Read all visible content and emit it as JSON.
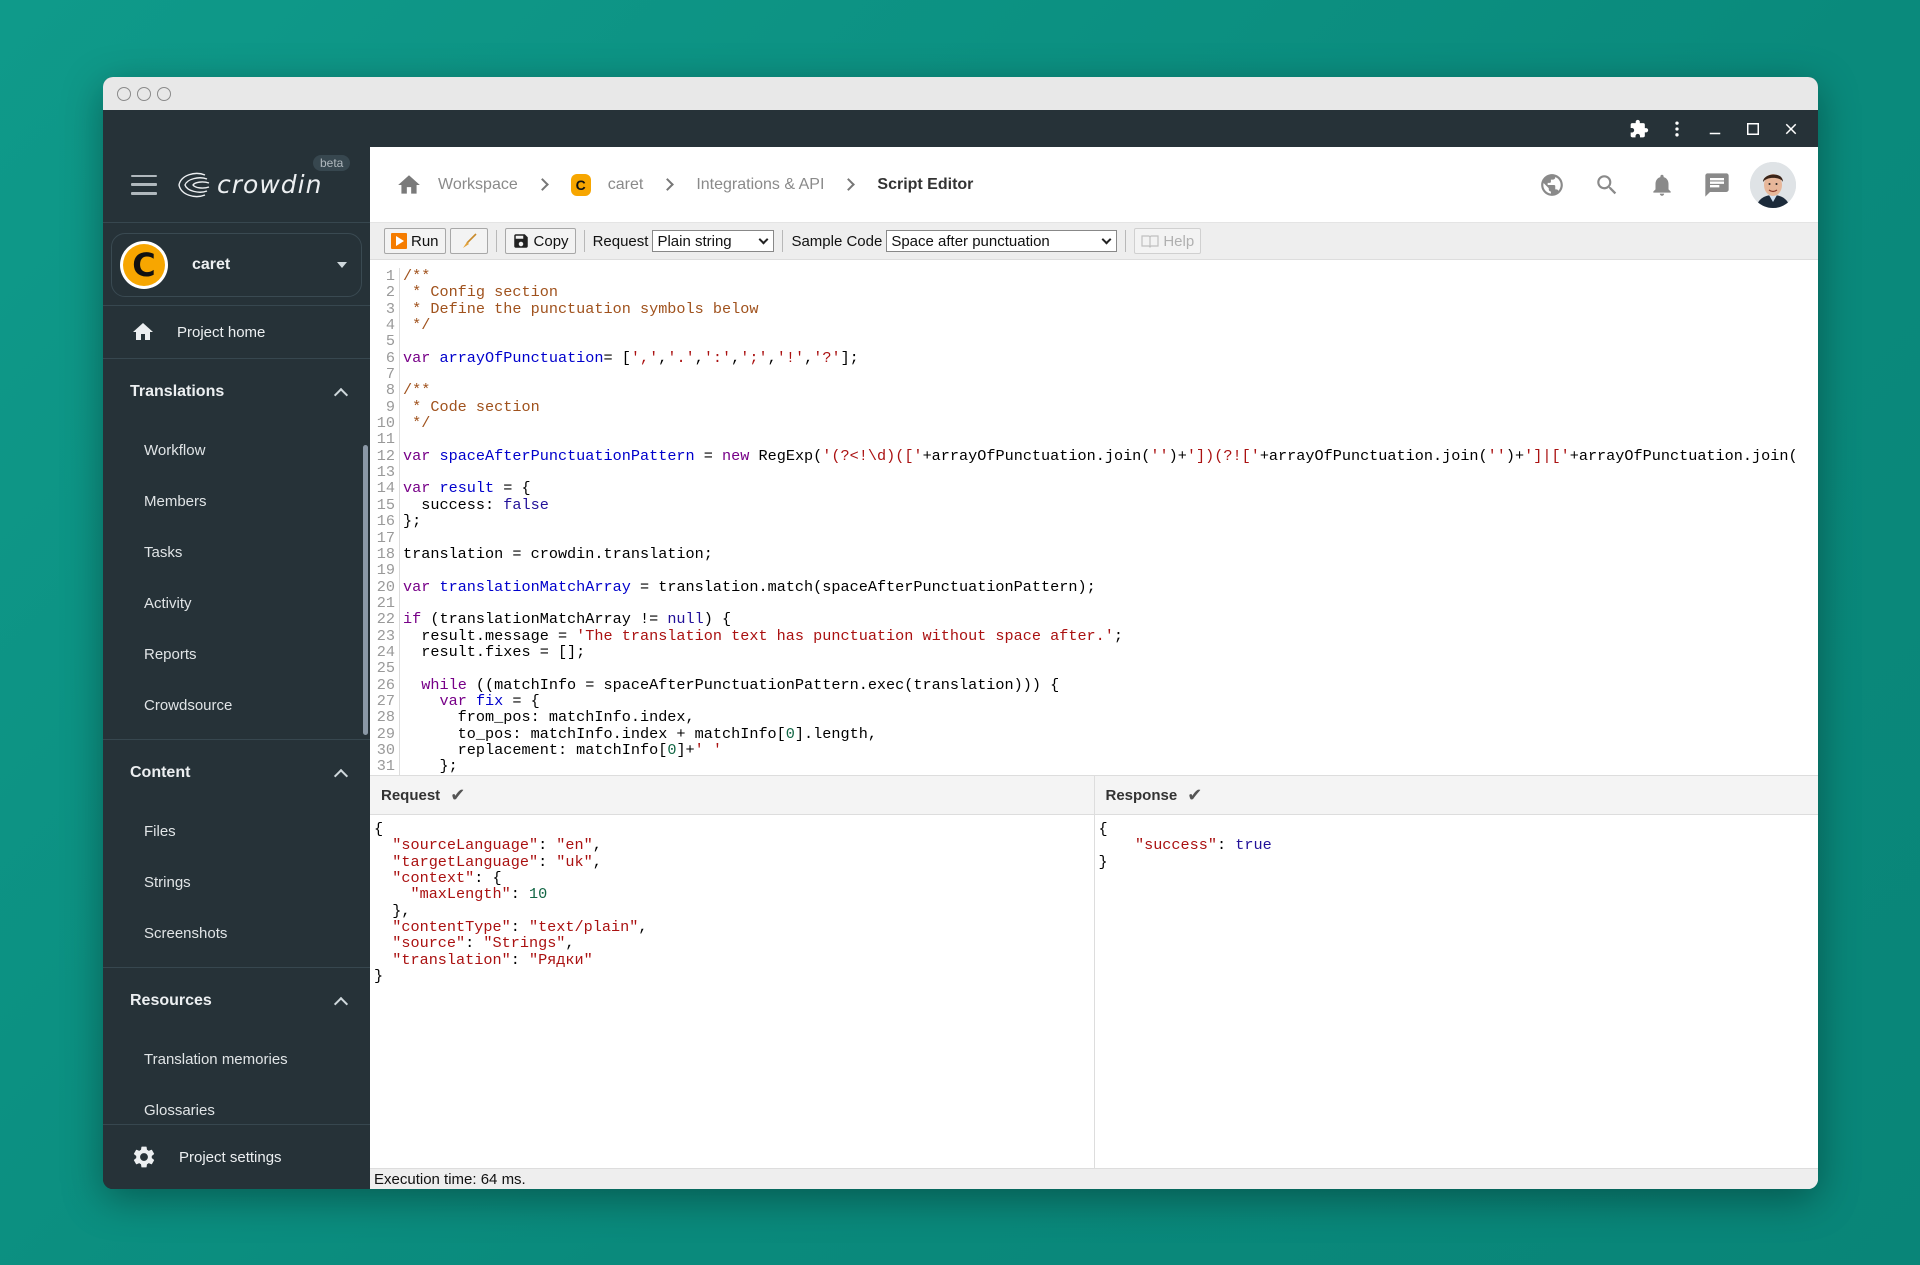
{
  "window": {
    "topbar_icons": [
      "extension-icon",
      "more-vert-icon",
      "minimize-icon",
      "maximize-icon",
      "close-icon"
    ]
  },
  "sidebar": {
    "brand": "crowdin",
    "beta_badge": "beta",
    "project": {
      "initial": "C",
      "name": "caret",
      "color": "#f7a600"
    },
    "project_home": "Project home",
    "sections": [
      {
        "title": "Translations",
        "items": [
          "Workflow",
          "Members",
          "Tasks",
          "Activity",
          "Reports",
          "Crowdsource"
        ]
      },
      {
        "title": "Content",
        "items": [
          "Files",
          "Strings",
          "Screenshots"
        ]
      },
      {
        "title": "Resources",
        "items": [
          "Translation memories",
          "Glossaries"
        ]
      }
    ],
    "project_settings": "Project settings"
  },
  "header": {
    "breadcrumb": {
      "workspace": "Workspace",
      "project": "caret",
      "project_initial": "C",
      "section": "Integrations & API",
      "current": "Script Editor"
    },
    "actions": [
      "language-icon",
      "search-icon",
      "notifications-icon",
      "messages-icon",
      "avatar"
    ]
  },
  "toolbar": {
    "run_label": "Run",
    "copy_label": "Copy",
    "request_label": "Request",
    "request_value": "Plain string",
    "sample_code_label": "Sample Code",
    "sample_code_value": "Space after punctuation",
    "help_label": "Help"
  },
  "editor": {
    "lines": [
      [
        [
          "c-com",
          "/**"
        ]
      ],
      [
        [
          "c-com",
          " * Config section"
        ]
      ],
      [
        [
          "c-com",
          " * Define the punctuation symbols below"
        ]
      ],
      [
        [
          "c-com",
          " */"
        ]
      ],
      [],
      [
        [
          "c-kw",
          "var "
        ],
        [
          "c-def",
          "arrayOfPunctuation"
        ],
        [
          "",
          "= ["
        ],
        [
          "c-str",
          "','"
        ],
        [
          "",
          ","
        ],
        [
          "c-str",
          "'.'"
        ],
        [
          "",
          ","
        ],
        [
          "c-str",
          "':'"
        ],
        [
          "",
          ","
        ],
        [
          "c-str",
          "';'"
        ],
        [
          "",
          ","
        ],
        [
          "c-str",
          "'!'"
        ],
        [
          "",
          ","
        ],
        [
          "c-str",
          "'?'"
        ],
        [
          "",
          "];"
        ]
      ],
      [],
      [
        [
          "c-com",
          "/**"
        ]
      ],
      [
        [
          "c-com",
          " * Code section"
        ]
      ],
      [
        [
          "c-com",
          " */"
        ]
      ],
      [],
      [
        [
          "c-kw",
          "var "
        ],
        [
          "c-def",
          "spaceAfterPunctuationPattern"
        ],
        [
          "",
          " = "
        ],
        [
          "c-kw",
          "new "
        ],
        [
          "",
          "RegExp("
        ],
        [
          "c-str",
          "'(?<!\\d)(['"
        ],
        [
          "",
          "+arrayOfPunctuation.join("
        ],
        [
          "c-str",
          "''"
        ],
        [
          "",
          ")+"
        ],
        [
          "c-str",
          "'])(?!['"
        ],
        [
          "",
          "+arrayOfPunctuation.join("
        ],
        [
          "c-str",
          "''"
        ],
        [
          "",
          ")+"
        ],
        [
          "c-str",
          "']|['"
        ],
        [
          "",
          "+arrayOfPunctuation.join("
        ]
      ],
      [],
      [
        [
          "c-kw",
          "var "
        ],
        [
          "c-def",
          "result"
        ],
        [
          "",
          " = {"
        ]
      ],
      [
        [
          "",
          "  success: "
        ],
        [
          "c-atom",
          "false"
        ]
      ],
      [
        [
          "",
          "};"
        ]
      ],
      [],
      [
        [
          "",
          "translation = crowdin.translation;"
        ]
      ],
      [],
      [
        [
          "c-kw",
          "var "
        ],
        [
          "c-def",
          "translationMatchArray"
        ],
        [
          "",
          " = translation.match(spaceAfterPunctuationPattern);"
        ]
      ],
      [],
      [
        [
          "c-kw",
          "if "
        ],
        [
          "",
          "(translationMatchArray != "
        ],
        [
          "c-atom",
          "null"
        ],
        [
          "",
          ") {"
        ]
      ],
      [
        [
          "",
          "  result.message = "
        ],
        [
          "c-str",
          "'The translation text has punctuation without space after.'"
        ],
        [
          "",
          ";"
        ]
      ],
      [
        [
          "",
          "  result.fixes = [];"
        ]
      ],
      [],
      [
        [
          "",
          "  "
        ],
        [
          "c-kw",
          "while "
        ],
        [
          "",
          "((matchInfo = spaceAfterPunctuationPattern.exec(translation))) {"
        ]
      ],
      [
        [
          "",
          "    "
        ],
        [
          "c-kw",
          "var "
        ],
        [
          "c-def",
          "fix"
        ],
        [
          "",
          " = {"
        ]
      ],
      [
        [
          "",
          "      from_pos: matchInfo.index,"
        ]
      ],
      [
        [
          "",
          "      to_pos: matchInfo.index + matchInfo["
        ],
        [
          "c-num",
          "0"
        ],
        [
          "",
          "].length,"
        ]
      ],
      [
        [
          "",
          "      replacement: matchInfo["
        ],
        [
          "c-num",
          "0"
        ],
        [
          "",
          "]+"
        ],
        [
          "c-str",
          "' '"
        ]
      ],
      [
        [
          "",
          "    };"
        ]
      ]
    ]
  },
  "request_panel": {
    "title": "Request",
    "status": "✔",
    "json": {
      "sourceLanguage": "en",
      "targetLanguage": "uk",
      "context_key": "context",
      "maxLength": 10,
      "contentType": "text/plain",
      "source": "Strings",
      "translation": "Рядки"
    }
  },
  "response_panel": {
    "title": "Response",
    "status": "✔",
    "json": {
      "success": true
    }
  },
  "status_bar": {
    "text": "Execution time: 64 ms."
  }
}
